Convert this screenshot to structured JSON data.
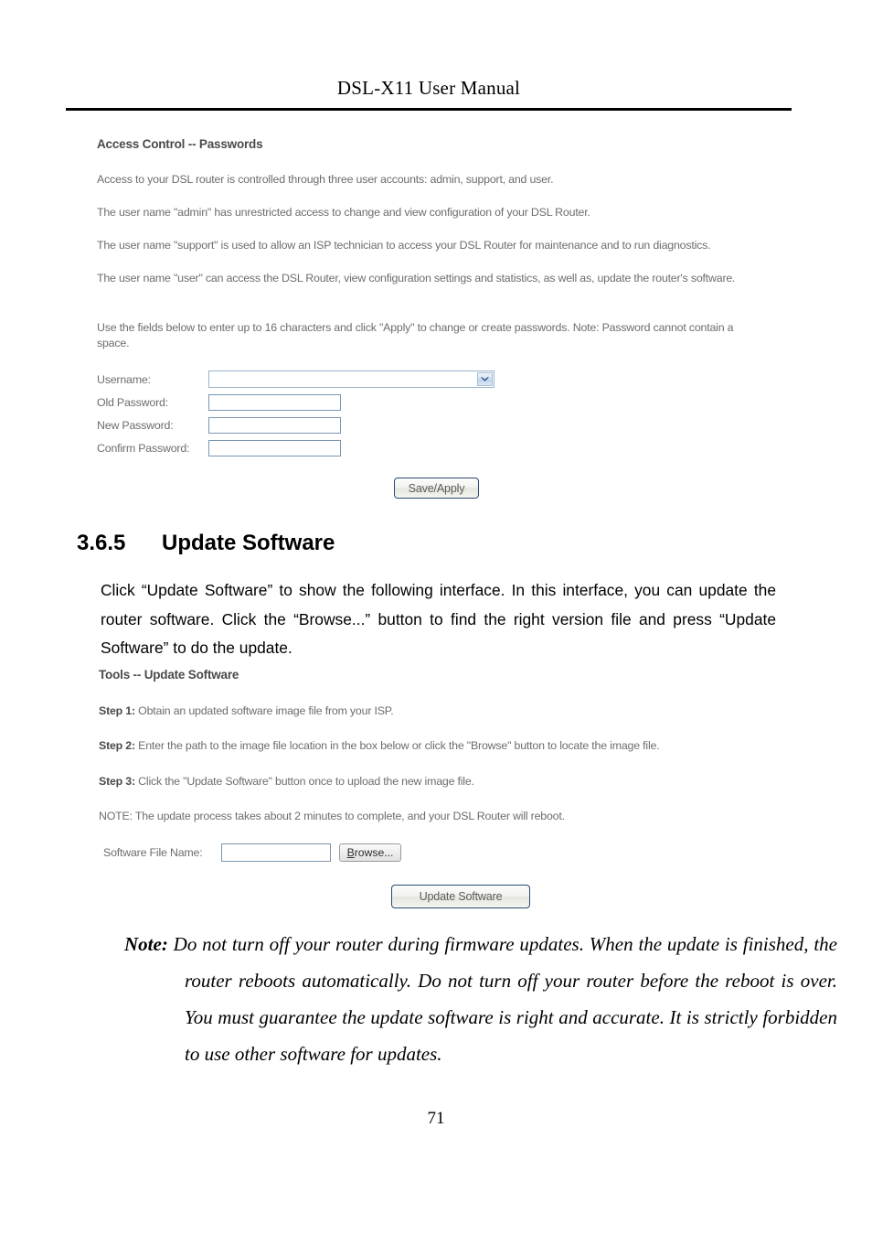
{
  "header": {
    "running_title": "DSL-X11 User Manual"
  },
  "access_control_panel": {
    "heading": "Access Control -- Passwords",
    "paragraphs": [
      "Access to your DSL router is controlled through three user accounts: admin, support, and user.",
      "The user name \"admin\" has unrestricted access to change and view configuration of your DSL Router.",
      "The user name \"support\" is used to allow an ISP technician to access your DSL Router for maintenance and to run diagnostics.",
      "The user name \"user\" can access the DSL Router, view configuration settings and statistics, as well as, update the router's software.",
      "Use the fields below to enter up to 16 characters and click \"Apply\" to change or create passwords. Note: Password cannot contain a space."
    ],
    "fields": {
      "username_label": "Username:",
      "username_value": "",
      "old_password_label": "Old Password:",
      "old_password_value": "",
      "new_password_label": "New Password:",
      "new_password_value": "",
      "confirm_password_label": "Confirm Password:",
      "confirm_password_value": ""
    },
    "save_apply_label": "Save/Apply"
  },
  "section": {
    "number": "3.6.5",
    "title": "Update Software",
    "body": "Click “Update Software” to show the following interface. In this interface, you can update the router software. Click the “Browse...” button to find the right version file and press “Update Software” to do the update."
  },
  "update_software_panel": {
    "heading": "Tools -- Update Software",
    "steps": [
      {
        "label": "Step 1:",
        "text": " Obtain an updated software image file from your ISP."
      },
      {
        "label": "Step 2:",
        "text": " Enter the path to the image file location in the box below or click the \"Browse\" button to locate the image file."
      },
      {
        "label": "Step 3:",
        "text": " Click the \"Update Software\" button once to upload the new image file."
      }
    ],
    "note": "NOTE: The update process takes about 2 minutes to complete, and your DSL Router will reboot.",
    "file_label": "Software File Name:",
    "file_value": "",
    "browse_accel": "B",
    "browse_rest": "rowse...",
    "update_button_label": "Update Software"
  },
  "note_block": {
    "label": "Note:",
    "text": " Do not turn off your router during firmware updates. When the update is finished, the router reboots automatically. Do not turn off your router before the reboot is over. You must guarantee the update software is right and accurate. It is strictly forbidden to use other software for updates."
  },
  "footer": {
    "page_number": "71"
  },
  "colors": {
    "input_border": "#7b96b0",
    "ui_text": "#6d6d6d",
    "ui_heading": "#4a4a4a",
    "button_border": "#2a4a72"
  }
}
